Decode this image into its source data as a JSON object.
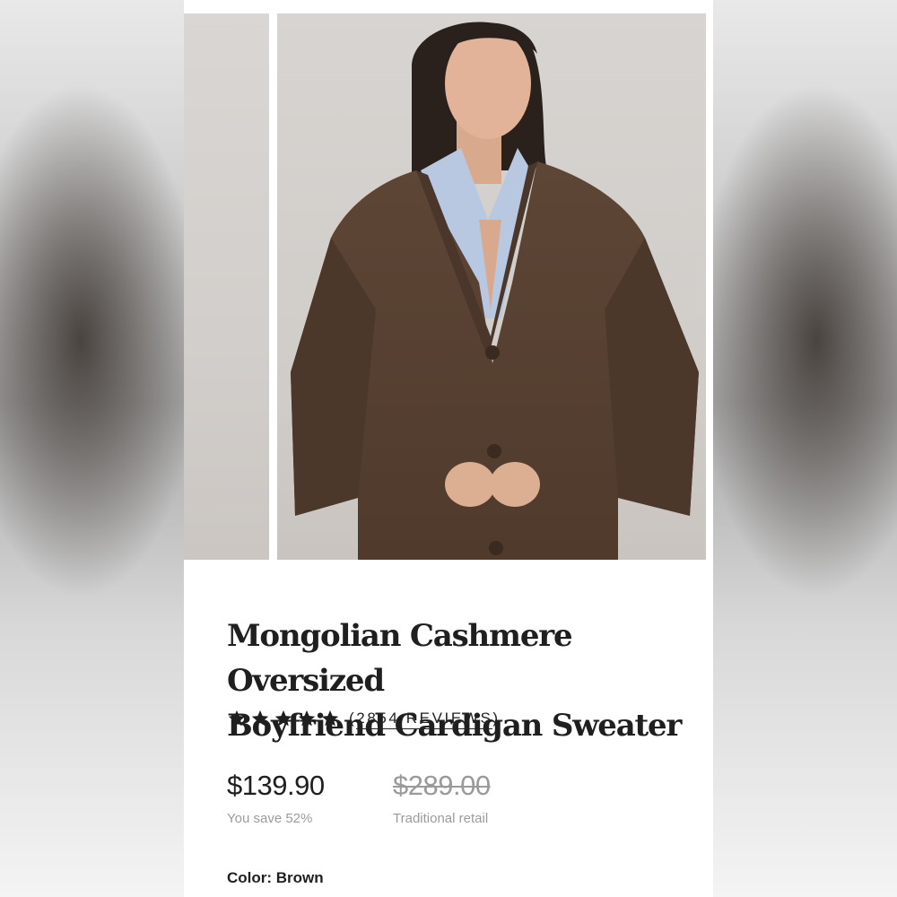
{
  "product": {
    "title_line1": "Mongolian Cashmere Oversized",
    "title_line2": "Boyfriend Cardigan Sweater",
    "rating_stars": 5,
    "reviews_label": "(2854 REVIEWS)",
    "reviews_open": "(",
    "reviews_text": "2854 REVIEWS",
    "reviews_close": ")",
    "price_sale": "$139.90",
    "price_retail": "$289.00",
    "savings_text": "You save 52%",
    "retail_label": "Traditional retail",
    "color_label": "Color:",
    "color_value": "Brown"
  },
  "colors": {
    "background": "#ffffff",
    "text": "#1f1f1f",
    "muted": "#9b9b9b",
    "sweater": "#5b4434",
    "shirt": "#a9bedb"
  },
  "icons": {
    "star": "star-icon"
  }
}
